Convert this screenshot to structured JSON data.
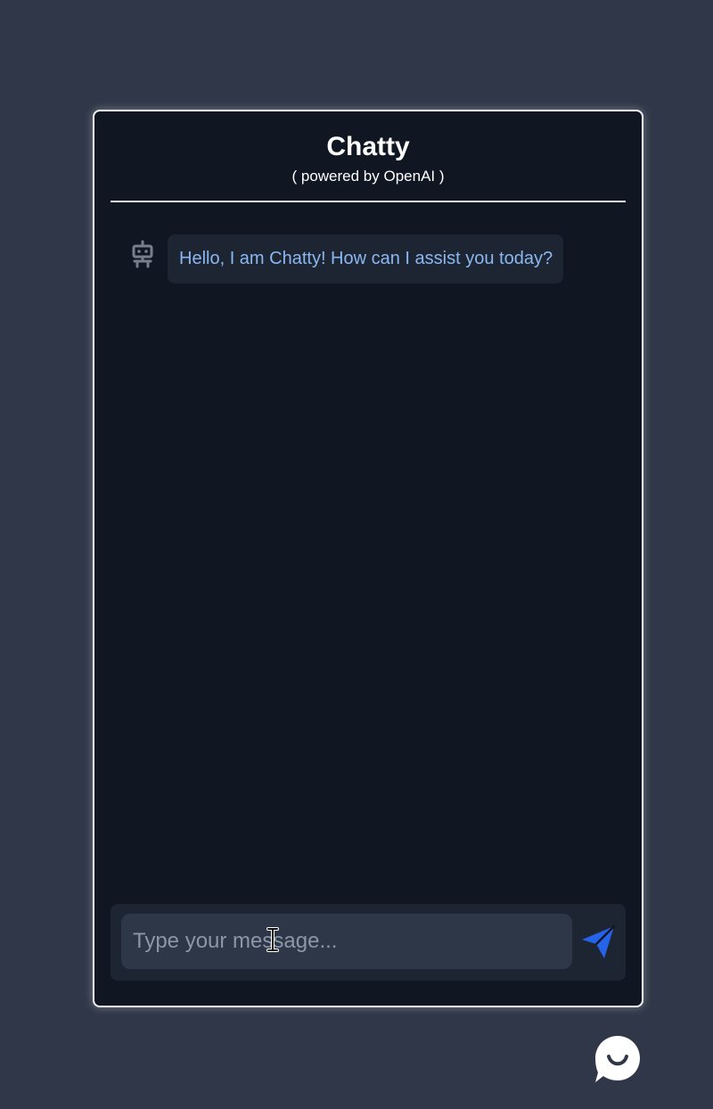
{
  "header": {
    "title": "Chatty",
    "subtitle": "( powered by OpenAI )"
  },
  "messages": [
    {
      "sender": "bot",
      "avatar_icon": "robot-icon",
      "text": "Hello, I am Chatty! How can I assist you today?"
    }
  ],
  "composer": {
    "placeholder": "Type your message...",
    "value": "",
    "send_icon": "send-icon"
  },
  "launcher": {
    "icon": "chat-bubble-icon"
  },
  "colors": {
    "background": "#2f3748",
    "panel": "#111623",
    "bubble": "#1e2532",
    "bubble_text": "#8ab7f1",
    "input": "#2e3748",
    "accent": "#2563eb"
  }
}
